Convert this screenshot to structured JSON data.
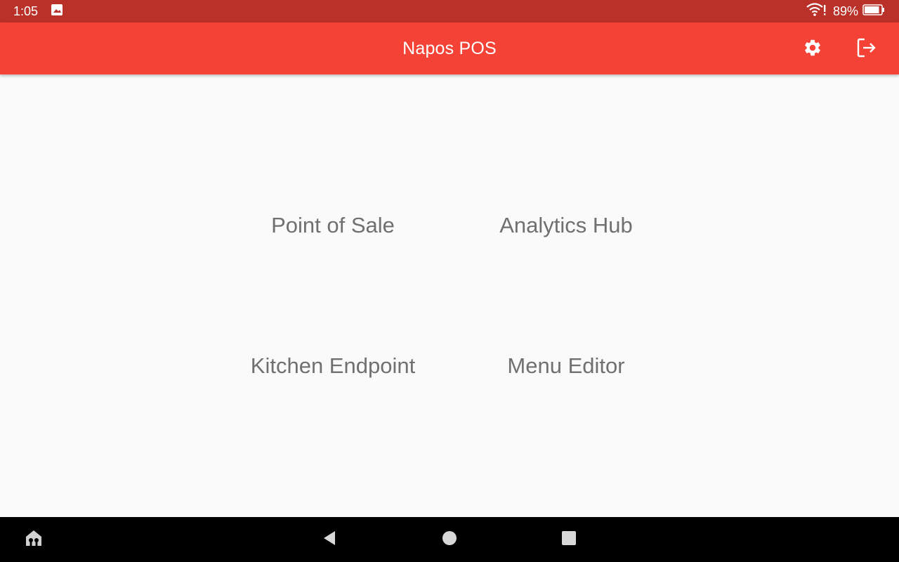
{
  "status_bar": {
    "time": "1:05",
    "battery_percent": "89%",
    "battery_level": 0.89,
    "icons": [
      "image-icon",
      "wifi-alert-icon",
      "battery-icon"
    ]
  },
  "app_bar": {
    "title": "Napos POS",
    "actions": [
      "settings-icon",
      "logout-icon"
    ]
  },
  "menu": {
    "items": [
      {
        "label": "Point of Sale"
      },
      {
        "label": "Analytics Hub"
      },
      {
        "label": "Kitchen Endpoint"
      },
      {
        "label": "Menu Editor"
      }
    ]
  },
  "nav_bar": {
    "buttons": [
      "home-shortcut-icon",
      "back-icon",
      "home-icon",
      "recents-icon"
    ]
  },
  "colors": {
    "status_bar": "#b93128",
    "app_bar": "#f44336",
    "background": "#fafafa",
    "tile_text": "#707070",
    "nav_bar": "#000000"
  }
}
